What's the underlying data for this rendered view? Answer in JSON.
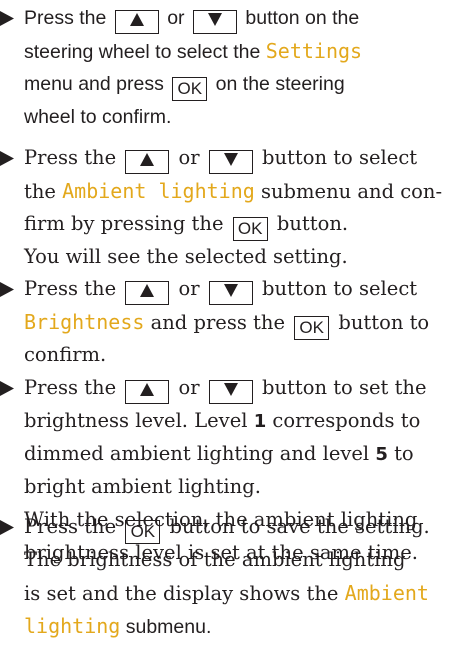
{
  "up_button": "▲",
  "down_button": "▼",
  "ok_label": "OK",
  "steps": [
    {
      "l1a": "Press the ",
      "l1b": " or ",
      "l1c": " button on the",
      "l2a": "steering wheel to select the ",
      "l2menu": "Settings",
      "l3a": "menu and press ",
      "l3b": " on the steering",
      "l4": "wheel to confirm."
    },
    {
      "l1a": "Press the ",
      "l1b": " or ",
      "l1c": " button to select",
      "l2a": "the ",
      "l2menu": "Ambient lighting",
      "l2b": " submenu and con-",
      "l3a": "firm by pressing the ",
      "l3b": " button.",
      "l4": "You will see the selected setting."
    },
    {
      "l1a": "Press the ",
      "l1b": " or ",
      "l1c": " button to select",
      "l2menu": "Brightness",
      "l2b": " and press the ",
      "l2c": " button to",
      "l3": "confirm."
    },
    {
      "l1a": "Press the ",
      "l1b": " or ",
      "l1c": " button to set the",
      "l2a": "brightness level. Level ",
      "l2num": "1",
      "l2b": " corresponds to",
      "l3a": "dimmed ambient lighting and level ",
      "l3num": "5",
      "l3b": " to",
      "l4": "bright ambient lighting.",
      "l5": "With the selection, the ambient lighting",
      "l6": "brightness level is set at the same time."
    },
    {
      "l1a": "Press the ",
      "l1b": " button to save the setting.",
      "l2": "The brightness of the ambient lighting",
      "l3a": "is set and the display shows the ",
      "l3menu": "Ambient",
      "l4menu": "lighting",
      "l4b": " submenu."
    }
  ]
}
